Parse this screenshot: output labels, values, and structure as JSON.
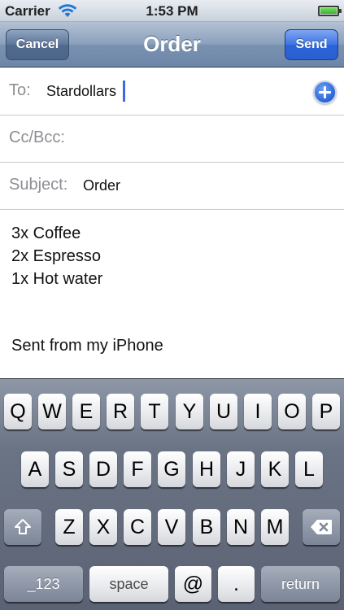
{
  "status_bar": {
    "carrier": "Carrier",
    "time": "1:53 PM",
    "wifi_icon": "wifi-icon",
    "battery_icon": "battery-icon"
  },
  "nav": {
    "title": "Order",
    "cancel_label": "Cancel",
    "send_label": "Send"
  },
  "fields": {
    "to_label": "To:",
    "to_value": "Stardollars",
    "cc_label": "Cc/Bcc:",
    "subject_label": "Subject:",
    "subject_value": "Order",
    "add_contact_icon": "add-contact-icon"
  },
  "body": {
    "lines": [
      "3x Coffee",
      "2x Espresso",
      "1x Hot water",
      "Sent from my iPhone"
    ]
  },
  "keyboard": {
    "row1": [
      "Q",
      "W",
      "E",
      "R",
      "T",
      "Y",
      "U",
      "I",
      "O",
      "P"
    ],
    "row2": [
      "A",
      "S",
      "D",
      "F",
      "G",
      "H",
      "J",
      "K",
      "L"
    ],
    "row3": [
      "Z",
      "X",
      "C",
      "V",
      "B",
      "N",
      "M"
    ],
    "shift_icon": "shift-icon",
    "delete_icon": "delete-icon",
    "numbers_label": "_123",
    "space_label": "space",
    "at_label": "@",
    "period_label": ".",
    "return_label": "return"
  },
  "colors": {
    "send_button": "#2c64d8",
    "nav_bar": "#7a92b1",
    "cursor": "#3b6bdc"
  }
}
